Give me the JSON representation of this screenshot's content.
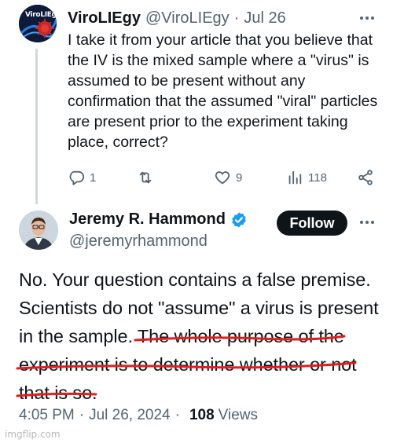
{
  "reply": {
    "avatar_logo_text": "ViroLIEgy",
    "display_name": "ViroLIEgy",
    "handle": "@ViroLIEgy",
    "separator": "·",
    "date": "Jul 26",
    "text": "I take it from your article that you believe that the IV is the mixed sample where a \"virus\" is assumed to be present without any confirmation that the assumed \"viral\" particles are present prior to the experiment taking place, correct?",
    "actions": {
      "reply_count": "1",
      "retweet_count": "",
      "like_count": "9",
      "views_count": "118"
    },
    "icons": [
      "more-icon",
      "reply-icon",
      "retweet-icon",
      "like-icon",
      "views-icon",
      "share-icon"
    ]
  },
  "main": {
    "display_name": "Jeremy R. Hammond",
    "handle": "@jeremyrhammond",
    "follow_label": "Follow",
    "verified": true,
    "text_plain": "No. Your question contains a false premise. Scientists do not \"assume\" a virus is present in the sample. ",
    "text_underlined": "The whole purpose of the experiment is to determine whether or not that is so.",
    "time": "4:05 PM",
    "date_separator": "·",
    "date": "Jul 26, 2024",
    "views_separator": "·",
    "views_count": "108",
    "views_label": "Views"
  },
  "watermark": "imgflip.com",
  "colors": {
    "text_primary": "#0f1419",
    "text_secondary": "#536471",
    "verified_blue": "#1d9bf0",
    "underline_red": "#e01e1e",
    "follow_bg": "#0f1419"
  }
}
